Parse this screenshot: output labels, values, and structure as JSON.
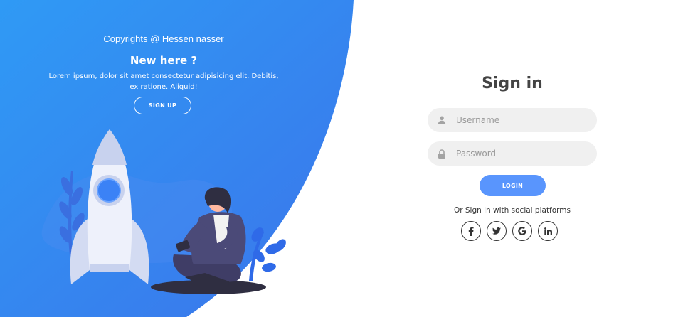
{
  "left_panel": {
    "copyright": "Copyrights @ Hessen nasser",
    "heading": "New here ?",
    "description": "Lorem ipsum, dolor sit amet consectetur adipisicing elit. Debitis, ex ratione. Aliquid!",
    "signup_label": "SIGN UP"
  },
  "form": {
    "title": "Sign in",
    "username": {
      "placeholder": "Username",
      "icon": "user-icon"
    },
    "password": {
      "placeholder": "Password",
      "icon": "lock-icon"
    },
    "login_label": "LOGIN",
    "social_text": "Or Sign in with social platforms",
    "social": [
      {
        "name": "facebook",
        "glyph": "f"
      },
      {
        "name": "twitter",
        "glyph": "t"
      },
      {
        "name": "google",
        "glyph": "G"
      },
      {
        "name": "linkedin",
        "glyph": "in"
      }
    ]
  },
  "colors": {
    "primary_blue": "#4481eb",
    "light_blue": "#04befe",
    "login_button": "#5995fd",
    "field_bg": "#f0f0f0",
    "title_text": "#444444"
  }
}
